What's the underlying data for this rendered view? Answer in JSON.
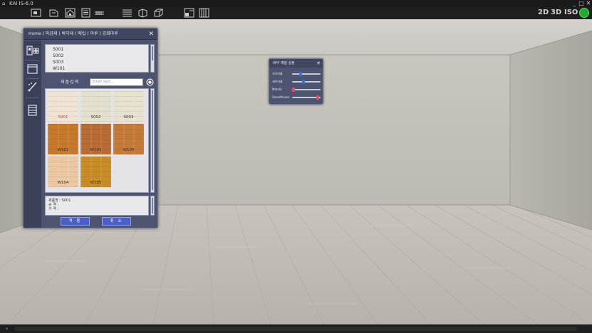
{
  "app": {
    "title": "KAI IS-6.0"
  },
  "window_controls": [
    "_",
    "□",
    "✕"
  ],
  "toolbar": {
    "left_icons": [
      "new-file-icon",
      "open-folder-icon",
      "home-icon",
      "document-icon",
      "ruler-icon"
    ],
    "center_icons": [
      "layers-icon",
      "box-icon",
      "cube-icon",
      "floorplan-icon",
      "grid-icon"
    ],
    "view_modes": [
      "2D",
      "3D",
      "ISO"
    ],
    "power_icon": "power-icon"
  },
  "material_panel": {
    "breadcrumb": "Home ( 마감재 ( 바닥재 ( 매립 ( 마루 ( 강화마루",
    "close": "✕",
    "sidebar_icons": [
      "furniture-icon",
      "window-icon",
      "paint-brush-icon",
      "list-icon"
    ],
    "codes": [
      "S001",
      "S002",
      "S003",
      "W101"
    ],
    "search_label": "제품검색",
    "search_placeholder": "Enter text...",
    "tiles": [
      {
        "label": "S001",
        "color": "#efe3d4",
        "label_color": "#d04040"
      },
      {
        "label": "S002",
        "color": "#e3e1cd",
        "label_color": "#333333"
      },
      {
        "label": "S003",
        "color": "#e6e2cf",
        "label_color": "#333333"
      },
      {
        "label": "W101",
        "color": "#c8782a",
        "label_color": "#333333"
      },
      {
        "label": "W102",
        "color": "#b86c34",
        "label_color": "#333333"
      },
      {
        "label": "W103",
        "color": "#c47a36",
        "label_color": "#333333"
      },
      {
        "label": "W104",
        "color": "#ecc8a2",
        "label_color": "#333333"
      },
      {
        "label": "W105",
        "color": "#c88c24",
        "label_color": "#333333"
      }
    ],
    "info": {
      "line1": "제품명 : S001",
      "line2": "규 격 :",
      "line3": "가 격 :"
    },
    "apply_label": "적 용",
    "cancel_label": "취 소"
  },
  "floor_panel": {
    "title": "바닥 재질 설정",
    "close": "✕",
    "sliders": [
      {
        "label": "가로비율",
        "value": 0.3,
        "thumb_color": "#3b6fe0"
      },
      {
        "label": "세로비율",
        "value": 0.4,
        "thumb_color": "#3b6fe0"
      },
      {
        "label": "Metalic",
        "value": 0.05,
        "thumb_color": "#e0506a"
      },
      {
        "label": "Smoothness",
        "value": 0.9,
        "thumb_color": "#e0506a"
      }
    ]
  },
  "bottom_bar": {
    "arrow": "›"
  }
}
